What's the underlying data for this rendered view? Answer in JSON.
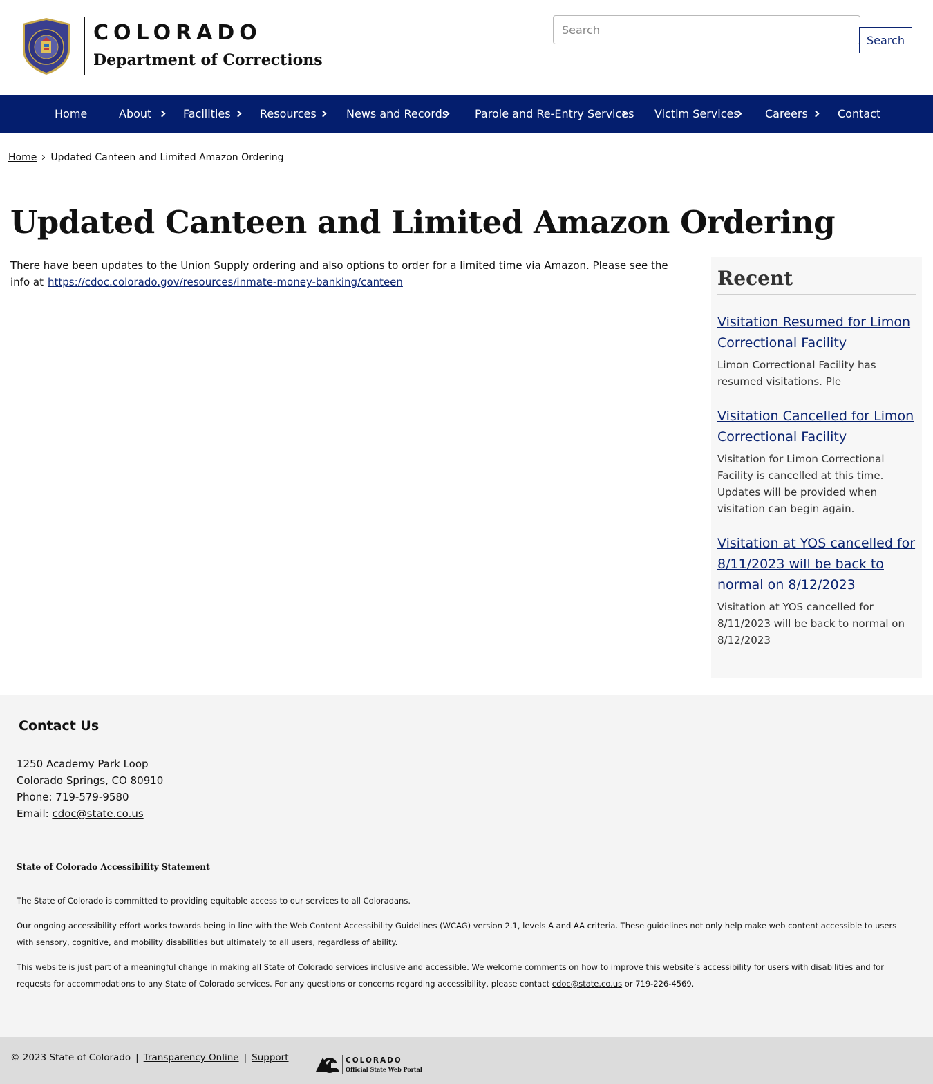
{
  "header": {
    "brand_state": "COLORADO",
    "brand_dept": "Department of Corrections",
    "seal_label": "COLORADO DEPARTMENT OF CORRECTIONS",
    "search_placeholder": "Search",
    "search_button": "Search"
  },
  "nav": {
    "items": [
      {
        "label": "Home"
      },
      {
        "label": "About"
      },
      {
        "label": "Facilities"
      },
      {
        "label": "Resources"
      },
      {
        "label": "News and Records"
      },
      {
        "label": "Parole and Re-Entry Services"
      },
      {
        "label": "Victim Services"
      },
      {
        "label": "Careers"
      },
      {
        "label": "Contact"
      }
    ]
  },
  "breadcrumb": {
    "home": "Home",
    "current": "Updated Canteen and Limited Amazon Ordering"
  },
  "main": {
    "title": "Updated Canteen and Limited Amazon Ordering",
    "body_text": "There have been updates to the Union Supply ordering and also options to order for a limited time via Amazon. Please see the info at",
    "body_link": "https://cdoc.colorado.gov/resources/inmate-money-banking/canteen"
  },
  "sidebar": {
    "heading": "Recent",
    "items": [
      {
        "title": "Visitation Resumed for Limon Correctional Facility",
        "desc": "Limon Correctional Facility has resumed visitations.  Ple"
      },
      {
        "title": "Visitation Cancelled for Limon Correctional Facility",
        "desc": "Visitation for Limon Correctional Facility is cancelled at this time. Updates will be provided when visitation can begin again."
      },
      {
        "title": "Visitation at YOS cancelled for 8/11/2023 will be back to normal on 8/12/2023",
        "desc": "Visitation at YOS cancelled for 8/11/2023 will be back to normal on 8/12/2023"
      }
    ]
  },
  "footer": {
    "contact_heading": "Contact Us",
    "address1": "1250 Academy Park Loop",
    "address2": "Colorado Springs, CO 80910",
    "phone": "Phone: 719-579-9580",
    "email_label": "Email:",
    "email": "cdoc@state.co.us",
    "a11y_heading": "State of Colorado Accessibility Statement",
    "a11y_p1": "The State of Colorado is committed to providing equitable access to our services to all Coloradans.",
    "a11y_p2": "Our ongoing accessibility effort works towards being in line with the Web Content Accessibility Guidelines (WCAG) version 2.1, levels A and AA criteria. These guidelines not only help make web content accessible to users with sensory, cognitive, and mobility disabilities but ultimately to all users, regardless of ability.",
    "a11y_p3": "This website is just part of a meaningful change in making all State of Colorado services inclusive and accessible. We welcome comments on how to improve this website’s accessibility for users with disabilities and for requests for accommodations to any State of Colorado services. For any questions or concerns regarding accessibility, please contact",
    "a11y_email": "cdoc@state.co.us",
    "a11y_phone": "or 719-226-4569."
  },
  "bottom": {
    "copyright": "© 2023 State of Colorado",
    "transparency": "Transparency Online",
    "support": "Support",
    "portal_title": "COLORADO",
    "portal_sub": "Official State Web Portal"
  },
  "colors": {
    "nav_bg": "#041e6e",
    "link": "#0b2471",
    "footer_bg": "#f4f4f4",
    "bottom_bar_bg": "#dcdcdc"
  }
}
